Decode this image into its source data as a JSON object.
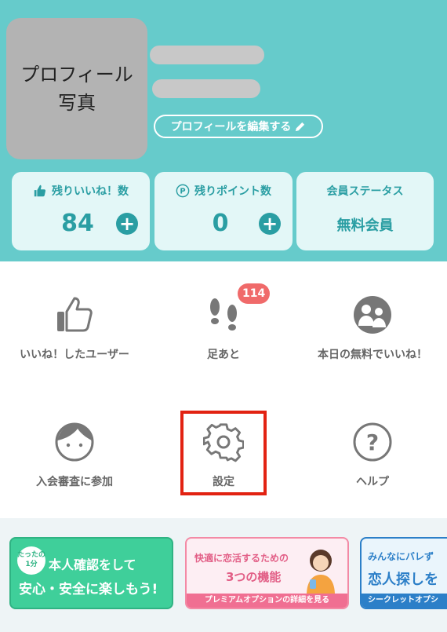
{
  "profile": {
    "photo_label": "プロフィール\n写真",
    "edit_label": "プロフィールを編集する"
  },
  "stats": {
    "likes_label": "残りいいね！数",
    "likes_value": "84",
    "points_label": "残りポイント数",
    "points_value": "0",
    "status_label": "会員ステータス",
    "status_value": "無料会員"
  },
  "menu": {
    "liked_users": "いいね！したユーザー",
    "footprints": "足あと",
    "footprints_badge": "114",
    "free_like": "本日の無料でいいね！",
    "join_review": "入会審査に参加",
    "settings": "設定",
    "help": "ヘルプ"
  },
  "banners": {
    "verify_small": "たったの\n1分",
    "verify_title": "本人確認をして",
    "verify_sub": "安心・安全に楽しもう!",
    "premium_title": "快適に恋活するための",
    "premium_sub": "3つの機能",
    "premium_foot": "プレミアムオプションの詳細を見る",
    "secret_title": "みんなにバレず",
    "secret_sub": "恋人探しを",
    "secret_foot": "シークレットオプシ"
  },
  "colors": {
    "header_bg": "#66cbcb",
    "accent": "#2a9ea3",
    "badge": "#f06a6a",
    "highlight": "#e22212"
  }
}
